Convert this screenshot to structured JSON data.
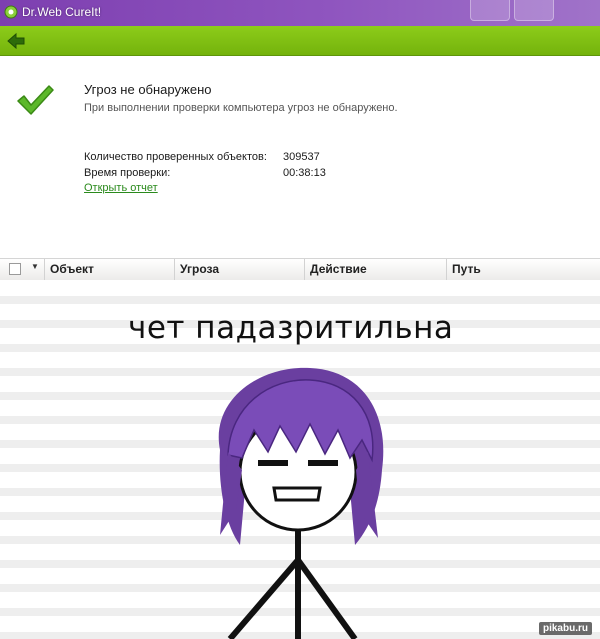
{
  "window": {
    "title": "Dr.Web CureIt!"
  },
  "toolbar": {
    "back_icon": "back-arrow-icon"
  },
  "summary": {
    "status_icon": "green-checkmark-icon",
    "heading": "Угроз не обнаружено",
    "subtext": "При выполнении проверки компьютера угроз не обнаружено.",
    "stats": [
      {
        "label": "Количество проверенных объектов:",
        "value": "309537"
      },
      {
        "label": "Время проверки:",
        "value": "00:38:13"
      }
    ],
    "report_link": "Открыть отчет"
  },
  "table": {
    "columns": [
      "Объект",
      "Угроза",
      "Действие",
      "Путь"
    ]
  },
  "meme": {
    "caption": "чет падазритильна"
  },
  "watermark": "pikabu.ru",
  "colors": {
    "titlebar": "#8a4fbf",
    "toolbar": "#7fbe12",
    "check": "#5cb82a",
    "link": "#2a8a1c",
    "hair": "#6a3fa0"
  }
}
